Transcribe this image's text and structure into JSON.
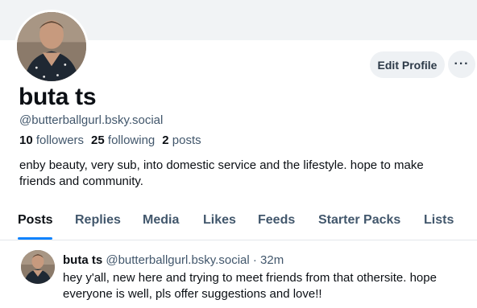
{
  "profile": {
    "display_name": "buta ts",
    "handle": "@butterballgurl.bsky.social",
    "followers_count": "10",
    "followers_label": "followers",
    "following_count": "25",
    "following_label": "following",
    "posts_count": "2",
    "posts_label": "posts",
    "bio": "enby beauty, very sub, into domestic service and the lifestyle. hope to make friends and community."
  },
  "actions": {
    "edit_profile_label": "Edit Profile",
    "more_label": "···"
  },
  "tabs": [
    {
      "label": "Posts",
      "active": true
    },
    {
      "label": "Replies"
    },
    {
      "label": "Media"
    },
    {
      "label": "Likes"
    },
    {
      "label": "Feeds"
    },
    {
      "label": "Starter Packs"
    },
    {
      "label": "Lists"
    }
  ],
  "feed": [
    {
      "author": "buta ts",
      "handle": "@butterballgurl.bsky.social",
      "separator": "·",
      "time": "32m",
      "text": "hey y'all, new here and trying to meet friends from that othersite. hope everyone is well, pls offer suggestions and love!!"
    }
  ],
  "colors": {
    "accent": "#1083fe",
    "muted_text": "#42576c",
    "banner": "#f1f3f5"
  }
}
